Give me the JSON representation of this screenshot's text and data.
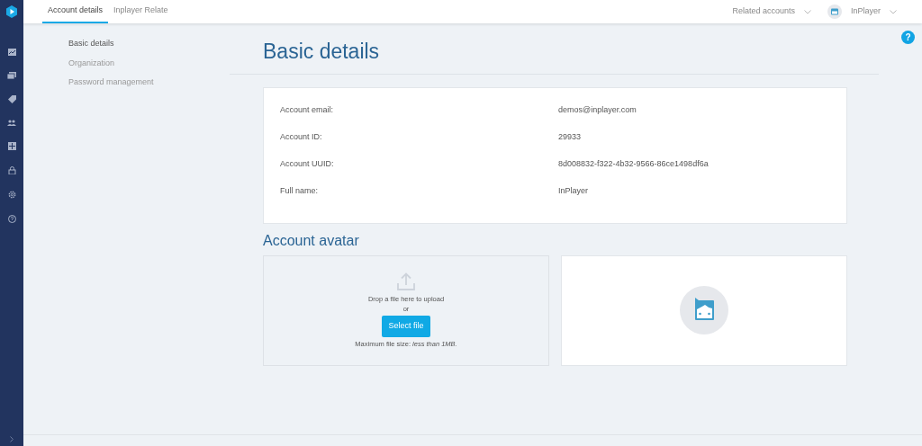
{
  "tabs": [
    {
      "label": "Account details",
      "selected": true
    },
    {
      "label": "Inplayer Relate",
      "selected": false
    }
  ],
  "top_right": {
    "related_accounts": "Related accounts",
    "user": "InPlayer"
  },
  "help": "?",
  "side_nav": [
    {
      "label": "Basic details",
      "selected": true
    },
    {
      "label": "Organization",
      "selected": false
    },
    {
      "label": "Password management",
      "selected": false
    }
  ],
  "page_title": "Basic details",
  "details": [
    {
      "label": "Account email:",
      "value": "demos@inplayer.com"
    },
    {
      "label": "Account ID:",
      "value": "29933"
    },
    {
      "label": "Account UUID:",
      "value": "8d008832-f322-4b32-9566-86ce1498df6a"
    },
    {
      "label": "Full name:",
      "value": "InPlayer"
    }
  ],
  "avatar": {
    "title": "Account avatar",
    "drop_text": "Drop a file here to upload",
    "or": "or",
    "button": "Select file",
    "max_size": "Maximum file size: *less than 1MB.*"
  }
}
